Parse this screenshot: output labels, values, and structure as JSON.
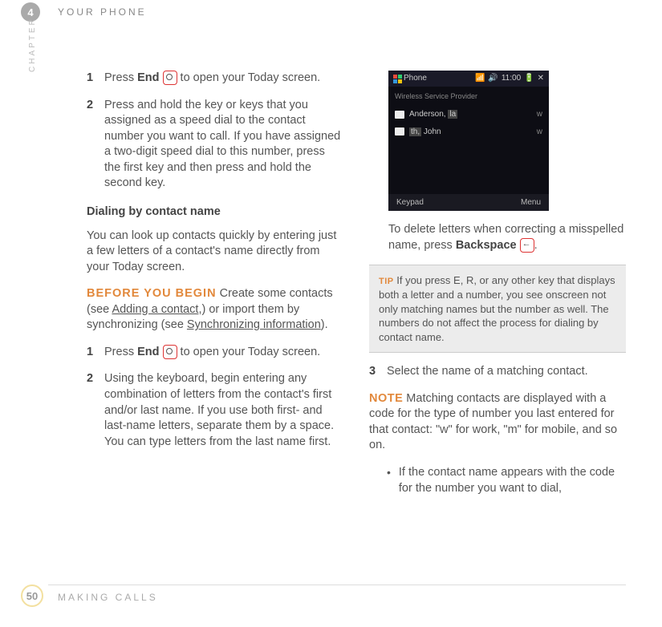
{
  "chapter_number": "4",
  "page_number": "50",
  "header": "YOUR PHONE",
  "footer": "MAKING CALLS",
  "side_label": "CHAPTER",
  "left": {
    "step1_num": "1",
    "step1_a": "Press ",
    "step1_b": "End",
    "step1_c": " to open your Today screen.",
    "step2_num": "2",
    "step2": "Press and hold the key or keys that you assigned as a speed dial to the contact number you want to call. If you have assigned a two-digit speed dial to this number, press the first key and then press and hold the second key.",
    "subhead": "Dialing by contact name",
    "para1": "You can look up contacts quickly by entering just a few letters of a contact's name directly from your Today screen.",
    "before_label": "BEFORE YOU BEGIN",
    "before_a": "  Create some contacts (see ",
    "before_link1": "Adding a contact,",
    "before_b": ") or import them by synchronizing (see ",
    "before_link2": "Synchronizing information",
    "before_c": ").",
    "step1b_num": "1",
    "step1b_a": "Press ",
    "step1b_b": "End",
    "step1b_c": " to open your Today screen.",
    "step2b_num": "2",
    "step2b": "Using the keyboard, begin entering any combination of letters from the contact's first and/or last name. If you use both first- and last-name letters, separate them by a space. You can type letters from the last name first."
  },
  "right": {
    "ss_title": "Phone",
    "ss_time": "11:00",
    "ss_provider": "Wireless Service Provider",
    "ss_contact1": "Anderson, ",
    "ss_contact1sfx": "la",
    "ss_contact2_pfx": "th,",
    "ss_contact2": " John",
    "ss_softkey_left": "Keypad",
    "ss_softkey_right": "Menu",
    "delete_a": "To delete letters when correcting a misspelled name, press ",
    "delete_b": "Backspace",
    "delete_c": ".",
    "tip_label": "TIP",
    "tip_text": " If you press E, R, or any other key that displays both a letter and a number, you see onscreen not only matching names but the number as well. The numbers do not affect the process for dialing by contact name.",
    "step3_num": "3",
    "step3": "Select the name of a matching contact.",
    "note_label": "NOTE",
    "note_text": "  Matching contacts are displayed with a code for the type of number you last entered for that contact: \"w\" for work, \"m\" for mobile, and so on.",
    "bullet1": "If the contact name appears with the code for the number you want to dial,"
  }
}
